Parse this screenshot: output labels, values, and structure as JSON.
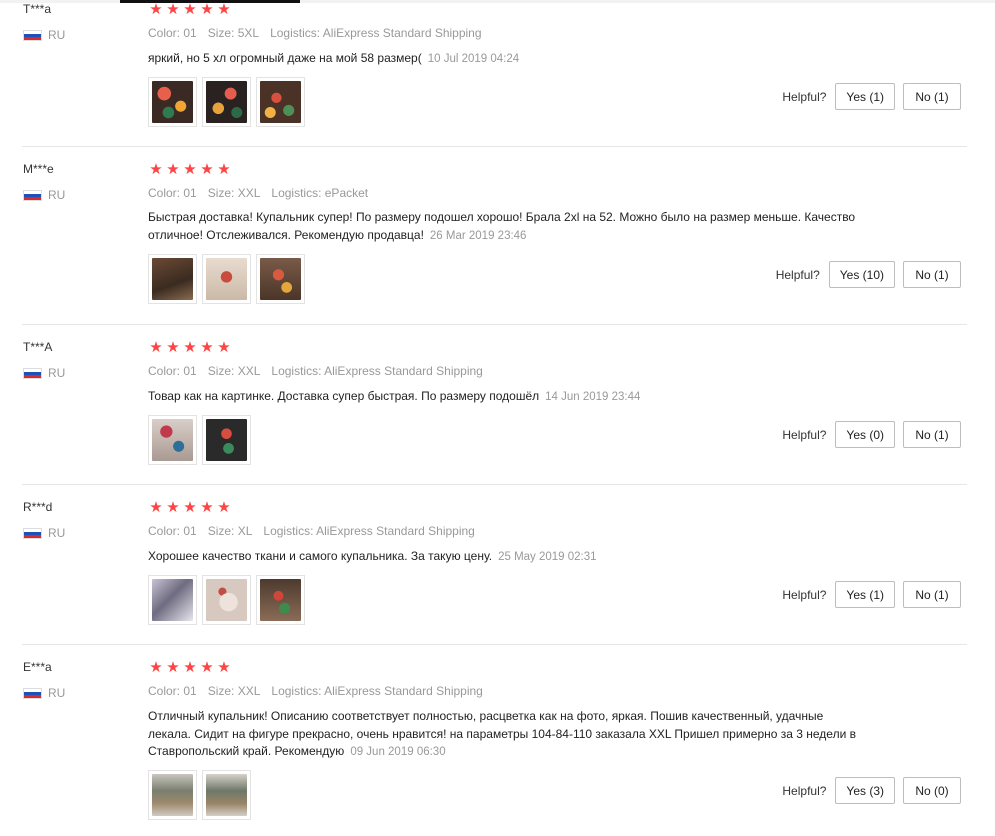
{
  "helpful_label": "Helpful?",
  "reviews": [
    {
      "user": "T***a",
      "country": "RU",
      "stars": 5,
      "color": "Color: 01",
      "size": "Size: 5XL",
      "logistics": "Logistics: AliExpress Standard Shipping",
      "text": "яркий, но 5 хл огромный даже на мой 58 размер(",
      "date": "10 Jul 2019 04:24",
      "yes": "Yes (1)",
      "no": "No (1)"
    },
    {
      "user": "M***e",
      "country": "RU",
      "stars": 5,
      "color": "Color: 01",
      "size": "Size: XXL",
      "logistics": "Logistics: ePacket",
      "text": "Быстрая доставка! Купальник супер! По размеру подошел хорошо! Брала 2xl на 52. Можно было на размер меньше. Качество отличное! Отслеживался. Рекомендую продавца!",
      "date": "26 Mar 2019 23:46",
      "yes": "Yes (10)",
      "no": "No (1)"
    },
    {
      "user": "T***A",
      "country": "RU",
      "stars": 5,
      "color": "Color: 01",
      "size": "Size: XXL",
      "logistics": "Logistics: AliExpress Standard Shipping",
      "text": "Товар как на картинке. Доставка супер быстрая. По размеру подошёл",
      "date": "14 Jun 2019 23:44",
      "yes": "Yes (0)",
      "no": "No (1)"
    },
    {
      "user": "R***d",
      "country": "RU",
      "stars": 5,
      "color": "Color: 01",
      "size": "Size: XL",
      "logistics": "Logistics: AliExpress Standard Shipping",
      "text": "Хорошее качество ткани и самого купальника. За такую цену.",
      "date": "25 May 2019 02:31",
      "yes": "Yes (1)",
      "no": "No (1)"
    },
    {
      "user": "E***a",
      "country": "RU",
      "stars": 5,
      "color": "Color: 01",
      "size": "Size: XXL",
      "logistics": "Logistics: AliExpress Standard Shipping",
      "text": "Отличный купальник! Описанию соответствует полностью, расцветка как на фото, яркая. Пошив качественный, удачные лекала. Сидит на фигуре прекрасно, очень нравится! на параметры 104-84-110 заказала XXL Пришел примерно за 3 недели в Ставропольский край. Рекомендую",
      "date": "09 Jun 2019 06:30",
      "yes": "Yes (3)",
      "no": "No (0)"
    }
  ]
}
